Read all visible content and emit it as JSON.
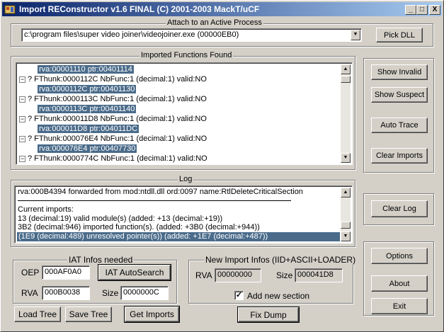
{
  "window": {
    "title": "Import REConstructor v1.6 FINAL (C) 2001-2003 MackT/uCF",
    "minimize": "_",
    "maximize": "□",
    "close": "X"
  },
  "attach": {
    "label": "Attach to an Active Process",
    "process": "c:\\program files\\super video joiner\\videojoiner.exe (00000EB0)",
    "pick_dll": "Pick DLL"
  },
  "imports": {
    "label": "Imported Functions Found",
    "rows": [
      {
        "text": "rva:00001110 ptr:00401114",
        "selected": true,
        "child": true
      },
      {
        "text": "? FThunk:0000112C NbFunc:1 (decimal:1) valid:NO",
        "selected": false,
        "child": false
      },
      {
        "text": "rva:0000112C ptr:00401130",
        "selected": true,
        "child": true
      },
      {
        "text": "? FThunk:0000113C NbFunc:1 (decimal:1) valid:NO",
        "selected": false,
        "child": false
      },
      {
        "text": "rva:0000113C ptr:00401140",
        "selected": true,
        "child": true
      },
      {
        "text": "? FThunk:000011D8 NbFunc:1 (decimal:1) valid:NO",
        "selected": false,
        "child": false
      },
      {
        "text": "rva:000011D8 ptr:004011DC",
        "selected": true,
        "child": true
      },
      {
        "text": "? FThunk:000076E4 NbFunc:1 (decimal:1) valid:NO",
        "selected": false,
        "child": false
      },
      {
        "text": "rva:000076E4 ptr:00407730",
        "selected": true,
        "child": true
      },
      {
        "text": "? FThunk:0000774C NbFunc:1 (decimal:1) valid:NO",
        "selected": false,
        "child": false
      }
    ],
    "expander": "−"
  },
  "side_buttons": {
    "show_invalid": "Show Invalid",
    "show_suspect": "Show Suspect",
    "auto_trace": "Auto Trace",
    "clear_imports": "Clear Imports",
    "clear_log": "Clear Log",
    "options": "Options",
    "about": "About",
    "exit": "Exit"
  },
  "log": {
    "label": "Log",
    "rows": [
      {
        "text": "rva:000B4394 forwarded from mod:ntdll.dll ord:0097 name:RtlDeleteCriticalSection",
        "selected": false
      },
      {
        "text": "",
        "selected": false
      },
      {
        "text": "Current imports:",
        "selected": false
      },
      {
        "text": "13 (decimal:19) valid module(s) (added: +13 (decimal:+19))",
        "selected": false
      },
      {
        "text": "3B2 (decimal:946) imported function(s). (added: +3B0 (decimal:+944))",
        "selected": false
      },
      {
        "text": "(1E9 (decimal:489) unresolved pointer(s)) (added: +1E7 (decimal:+487))",
        "selected": true
      }
    ]
  },
  "iat": {
    "label": "IAT Infos needed",
    "oep_label": "OEP",
    "oep": "000AF0A0",
    "autosearch": "IAT AutoSearch",
    "rva_label": "RVA",
    "rva": "000B0038",
    "size_label": "Size",
    "size": "0000000C"
  },
  "new_import": {
    "label": "New Import Infos (IID+ASCII+LOADER)",
    "rva_label": "RVA",
    "rva": "00000000",
    "size_label": "Size",
    "size": "000041D8",
    "add_section": "Add new section",
    "check": "✓"
  },
  "bottom_buttons": {
    "load_tree": "Load Tree",
    "save_tree": "Save Tree",
    "get_imports": "Get Imports",
    "fix_dump": "Fix Dump"
  },
  "scroll": {
    "up": "▲",
    "down": "▼"
  }
}
